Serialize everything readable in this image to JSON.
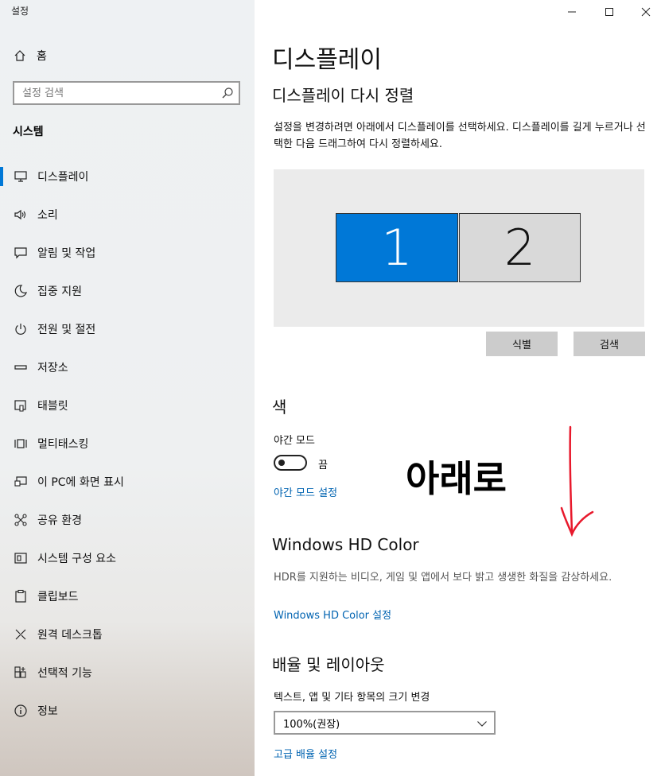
{
  "window": {
    "title": "설정"
  },
  "sidebar": {
    "home_label": "홈",
    "search_placeholder": "설정 검색",
    "section": "시스템",
    "items": [
      {
        "label": "디스플레이",
        "icon": "monitor-icon",
        "active": true
      },
      {
        "label": "소리",
        "icon": "speaker-icon"
      },
      {
        "label": "알림 및 작업",
        "icon": "notification-icon"
      },
      {
        "label": "집중 지원",
        "icon": "moon-icon"
      },
      {
        "label": "전원 및 절전",
        "icon": "power-icon"
      },
      {
        "label": "저장소",
        "icon": "storage-icon"
      },
      {
        "label": "태블릿",
        "icon": "tablet-icon"
      },
      {
        "label": "멀티태스킹",
        "icon": "multitasking-icon"
      },
      {
        "label": "이 PC에 화면 표시",
        "icon": "project-icon"
      },
      {
        "label": "공유 환경",
        "icon": "share-icon"
      },
      {
        "label": "시스템 구성 요소",
        "icon": "components-icon"
      },
      {
        "label": "클립보드",
        "icon": "clipboard-icon"
      },
      {
        "label": "원격 데스크톱",
        "icon": "remote-desktop-icon"
      },
      {
        "label": "선택적 기능",
        "icon": "optional-features-icon"
      },
      {
        "label": "정보",
        "icon": "info-icon"
      }
    ]
  },
  "main": {
    "title": "디스플레이",
    "rearrange": {
      "heading": "디스플레이 다시 정렬",
      "description": "설정을 변경하려면 아래에서 디스플레이를 선택하세요. 디스플레이를 길게 누르거나 선택한 다음 드래그하여 다시 정렬하세요.",
      "monitor1": "1",
      "monitor2": "2",
      "identify_button": "식별",
      "detect_button": "검색"
    },
    "color": {
      "heading": "색",
      "night_light_label": "야간 모드",
      "night_light_state": "끔",
      "night_light_on": false,
      "night_light_link": "야간 모드 설정"
    },
    "hdr": {
      "heading": "Windows HD Color",
      "description": "HDR를 지원하는 비디오, 게임 및 앱에서 보다 밝고 생생한 화질을 감상하세요.",
      "link": "Windows HD Color 설정"
    },
    "scale": {
      "heading": "배율 및 레이아웃",
      "size_label": "텍스트, 앱 및 기타 항목의 크기 변경",
      "size_value": "100%(권장)",
      "advanced_link": "고급 배율 설정"
    },
    "annotation": {
      "text": "아래로",
      "arrow_color": "#e8192c"
    }
  },
  "colors": {
    "accent": "#0078d7",
    "link": "#0063b1"
  }
}
